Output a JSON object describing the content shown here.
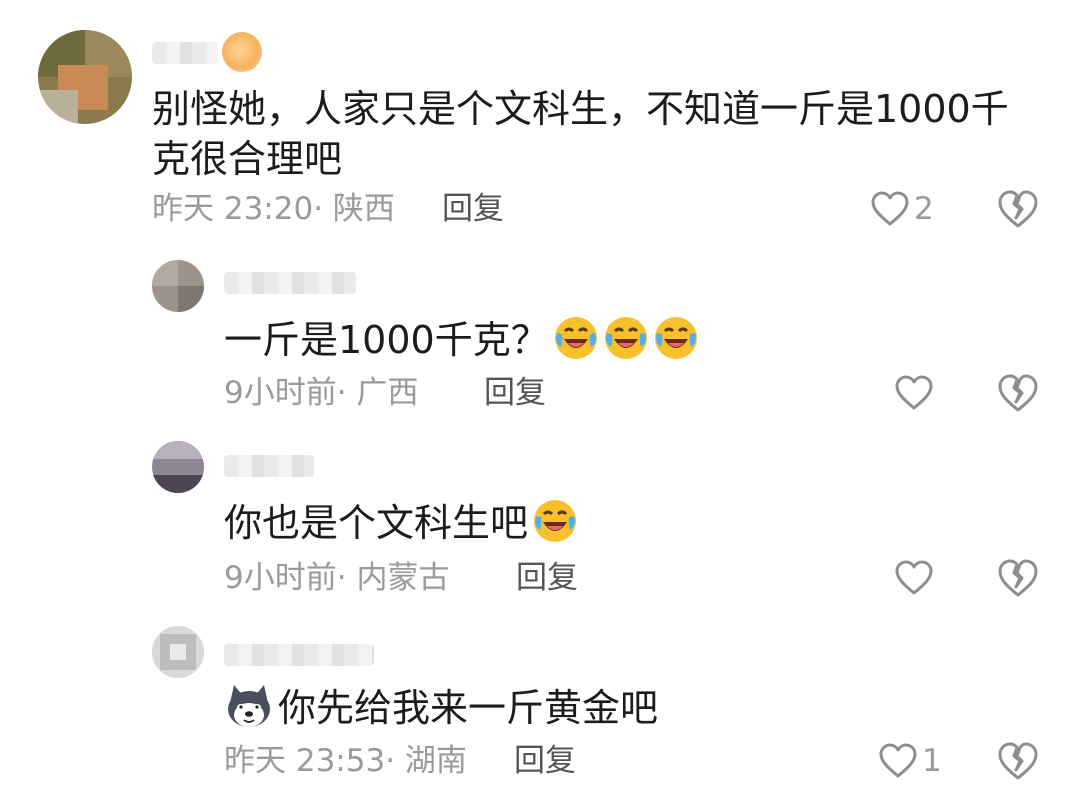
{
  "comments": [
    {
      "text_line1": "别怪她，人家只是个文科生，不知道一斤是1000千",
      "text_line2": "克很合理吧",
      "time": "昨天 23:20",
      "location": "· 陕西",
      "reply_label": "回复",
      "like_count": "2"
    },
    {
      "text": "一斤是1000千克？",
      "emojis": [
        "laughing-crying",
        "laughing-crying",
        "laughing-crying"
      ],
      "time": "9小时前",
      "location": "· 广西",
      "reply_label": "回复",
      "like_count": ""
    },
    {
      "text": "你也是个文科生吧",
      "emojis": [
        "laughing-crying"
      ],
      "time": "9小时前",
      "location": "· 内蒙古",
      "reply_label": "回复",
      "like_count": ""
    },
    {
      "text": "你先给我来一斤黄金吧",
      "prefix_emoji": "husky-dog",
      "time": "昨天 23:53",
      "location": "· 湖南",
      "reply_label": "回复",
      "like_count": "1"
    }
  ],
  "colors": {
    "text": "#1c1c1c",
    "meta": "#9a9a9a",
    "reply": "#555555",
    "icon": "#8e8e8e"
  },
  "icons": {
    "like": "heart-outline-icon",
    "dislike": "broken-heart-icon"
  }
}
